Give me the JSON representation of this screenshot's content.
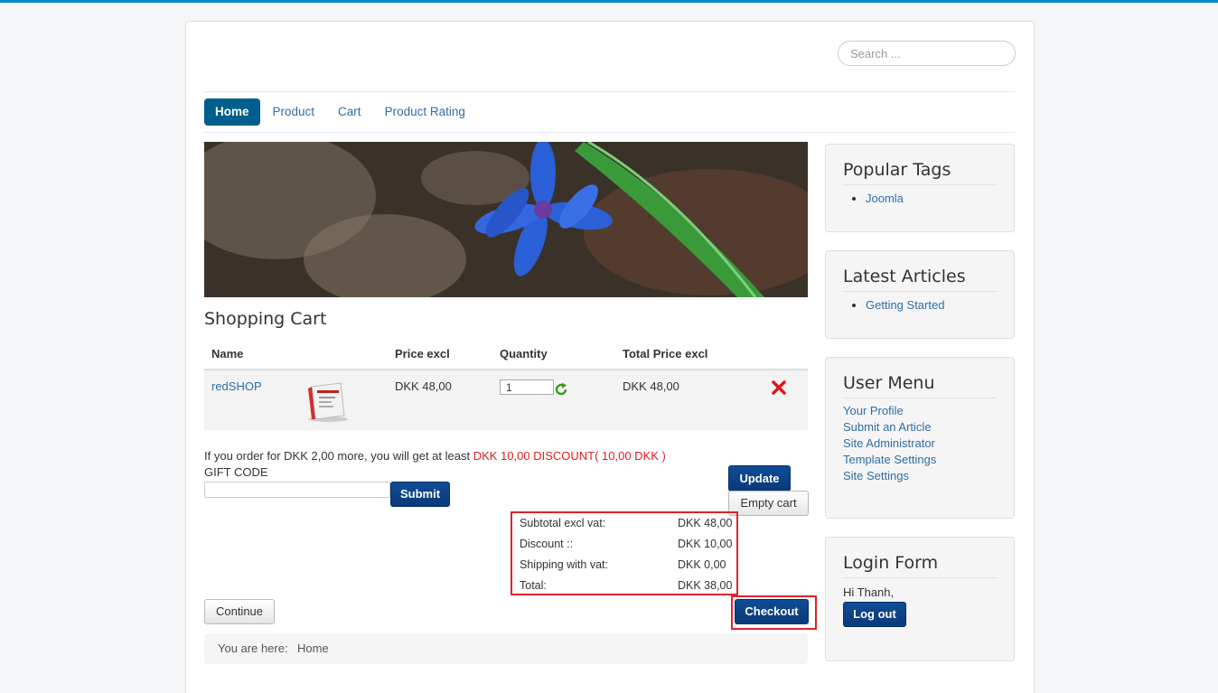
{
  "search": {
    "placeholder": "Search ..."
  },
  "nav": {
    "items": [
      "Home",
      "Product",
      "Cart",
      "Product Rating"
    ],
    "active": "Home"
  },
  "cart": {
    "title": "Shopping Cart",
    "columns": {
      "name": "Name",
      "price": "Price excl",
      "quantity": "Quantity",
      "total": "Total Price excl"
    },
    "items": [
      {
        "name": "redSHOP",
        "price": "DKK 48,00",
        "quantity": "1",
        "total": "DKK 48,00"
      }
    ],
    "discount_notice": "If you order for DKK 2,00 more, you will get at least ",
    "discount_highlight": "DKK 10,00 DISCOUNT( 10,00 DKK )",
    "gift_code_label": "GIFT CODE",
    "submit_label": "Submit",
    "update_label": "Update",
    "empty_cart_label": "Empty cart",
    "totals": [
      {
        "label": "Subtotal excl vat:",
        "value": "DKK 48,00"
      },
      {
        "label": "Discount ::",
        "value": "DKK 10,00"
      },
      {
        "label": "Shipping with vat:",
        "value": "DKK 0,00"
      },
      {
        "label": "Total:",
        "value": "DKK 38,00"
      }
    ],
    "continue_label": "Continue",
    "checkout_label": "Checkout"
  },
  "breadcrumb": {
    "prefix": "You are here:",
    "current": "Home"
  },
  "sidebar": {
    "popular_tags": {
      "title": "Popular Tags",
      "items": [
        "Joomla"
      ]
    },
    "latest_articles": {
      "title": "Latest Articles",
      "items": [
        "Getting Started"
      ]
    },
    "user_menu": {
      "title": "User Menu",
      "items": [
        "Your Profile",
        "Submit an Article",
        "Site Administrator",
        "Template Settings",
        "Site Settings"
      ]
    },
    "login_form": {
      "title": "Login Form",
      "greeting": "Hi Thanh,",
      "logout_label": "Log out"
    }
  },
  "colors": {
    "accent": "#0088cc",
    "nav_active": "#005e8d",
    "button_blue": "#0a3a78",
    "highlight_red": "#e0232d"
  }
}
